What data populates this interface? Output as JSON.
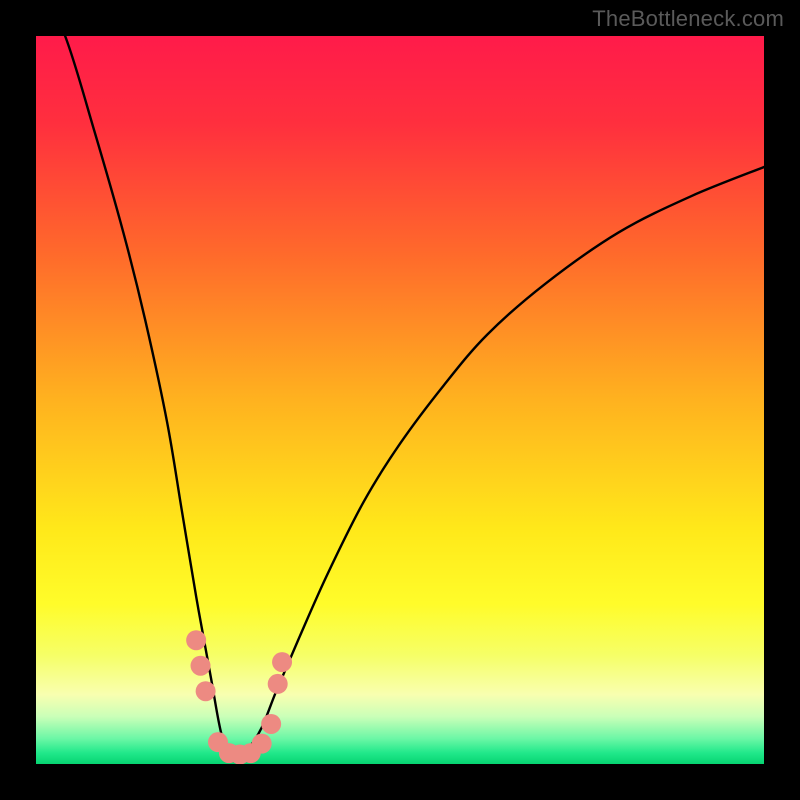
{
  "watermark": "TheBottleneck.com",
  "chart_data": {
    "type": "line",
    "title": "",
    "xlabel": "",
    "ylabel": "",
    "xlim": [
      0,
      100
    ],
    "ylim": [
      0,
      100
    ],
    "grid": false,
    "legend": false,
    "gradient_stops": [
      {
        "offset": 0.0,
        "color": "#ff1b4a"
      },
      {
        "offset": 0.12,
        "color": "#ff2f3e"
      },
      {
        "offset": 0.3,
        "color": "#ff6a2b"
      },
      {
        "offset": 0.5,
        "color": "#ffb21f"
      },
      {
        "offset": 0.68,
        "color": "#ffe91a"
      },
      {
        "offset": 0.78,
        "color": "#fffc2a"
      },
      {
        "offset": 0.85,
        "color": "#f6ff66"
      },
      {
        "offset": 0.905,
        "color": "#f8ffb0"
      },
      {
        "offset": 0.935,
        "color": "#caffb8"
      },
      {
        "offset": 0.965,
        "color": "#6cf7a6"
      },
      {
        "offset": 0.985,
        "color": "#20e88a"
      },
      {
        "offset": 1.0,
        "color": "#06d371"
      }
    ],
    "series": [
      {
        "name": "bottleneck-curve",
        "x": [
          0,
          4,
          8,
          12,
          15,
          18,
          20,
          22,
          24,
          25.5,
          27,
          29,
          31,
          33,
          36,
          40,
          45,
          50,
          56,
          62,
          70,
          80,
          90,
          100
        ],
        "values": [
          108,
          100,
          87,
          73,
          61,
          47,
          35,
          23,
          12,
          4,
          1,
          2,
          5,
          10,
          17,
          26,
          36,
          44,
          52,
          59,
          66,
          73,
          78,
          82
        ]
      }
    ],
    "markers": {
      "name": "highlight-points",
      "color": "#ed8a82",
      "points": [
        {
          "x": 22.0,
          "y": 17.0
        },
        {
          "x": 22.6,
          "y": 13.5
        },
        {
          "x": 23.3,
          "y": 10.0
        },
        {
          "x": 25.0,
          "y": 3.0
        },
        {
          "x": 26.5,
          "y": 1.5
        },
        {
          "x": 28.0,
          "y": 1.3
        },
        {
          "x": 29.5,
          "y": 1.5
        },
        {
          "x": 31.0,
          "y": 2.8
        },
        {
          "x": 32.3,
          "y": 5.5
        },
        {
          "x": 33.2,
          "y": 11.0
        },
        {
          "x": 33.8,
          "y": 14.0
        }
      ]
    }
  }
}
